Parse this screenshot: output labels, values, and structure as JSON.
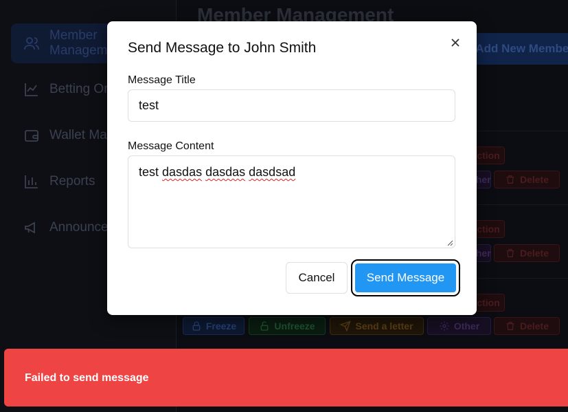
{
  "sidebar": {
    "items": [
      {
        "label": "Member Management",
        "icon": "users-icon",
        "active": true
      },
      {
        "label": "Betting Orders",
        "icon": "line-chart-icon",
        "active": false
      },
      {
        "label": "Wallet Management",
        "icon": "wallet-icon",
        "active": false
      },
      {
        "label": "Reports",
        "icon": "bar-chart-icon",
        "active": false
      },
      {
        "label": "Announcements",
        "icon": "megaphone-icon",
        "active": false
      }
    ]
  },
  "main": {
    "title": "Member Management",
    "add_button": "Add New Member",
    "row_actions": {
      "freeze": "Freeze",
      "unfreeze": "Unfreeze",
      "send_letter": "Send a letter",
      "other": "Other",
      "delete": "Delete",
      "action": "Action"
    }
  },
  "modal": {
    "title": "Send Message to John Smith",
    "title_label": "Message Title",
    "title_value": "test",
    "content_label": "Message Content",
    "content_first_word": "test",
    "content_misspelled": [
      "dasdas",
      "dasdas",
      "dasdsad"
    ],
    "cancel_label": "Cancel",
    "send_label": "Send Message"
  },
  "toast": {
    "message": "Failed to send message",
    "color": "#ef4444"
  },
  "colors": {
    "accent": "#2196f3",
    "background": "#0b0d12"
  }
}
